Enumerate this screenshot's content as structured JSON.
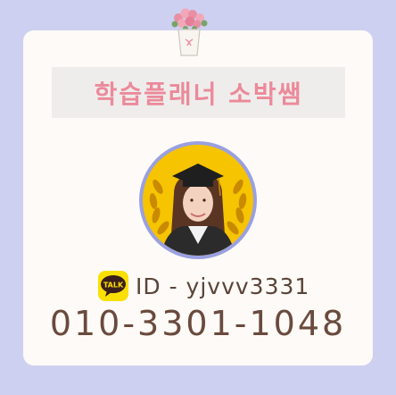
{
  "profile": {
    "title": "학습플래너 소박쌤",
    "kakao_badge": "TALK",
    "kakao_id": "ID - yjvvv3331",
    "phone": "010-3301-1048"
  },
  "icons": {
    "top": "flower-pot-icon",
    "kakao": "kakao-talk-icon",
    "avatar": "graduation-profile-photo"
  },
  "colors": {
    "background": "#cdd0f0",
    "card": "#fdfaf7",
    "title_box": "#efedec",
    "title_text": "#eb8a9a",
    "avatar_ring": "#9aa0e0",
    "avatar_bg": "#f6c400",
    "kakao_yellow": "#f9e000",
    "text_brown": "#5a4338"
  }
}
